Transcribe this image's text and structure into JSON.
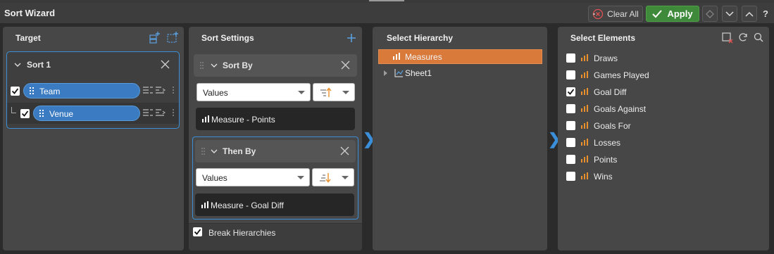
{
  "window": {
    "title": "Sort Wizard",
    "clear_all": "Clear All",
    "apply": "Apply",
    "help": "?"
  },
  "target": {
    "title": "Target",
    "sort_label": "Sort 1",
    "fields": [
      {
        "label": "Team",
        "checked": true
      },
      {
        "label": "Venue",
        "checked": true
      }
    ]
  },
  "sort_settings": {
    "title": "Sort Settings",
    "sort_by": {
      "label": "Sort By",
      "select_value": "Values",
      "direction": "ascending",
      "measure": "Measure - Points"
    },
    "then_by": {
      "label": "Then By",
      "select_value": "Values",
      "direction": "descending",
      "measure": "Measure - Goal Diff"
    },
    "break_hierarchies": {
      "label": "Break Hierarchies",
      "checked": true
    }
  },
  "hierarchy": {
    "title": "Select Hierarchy",
    "items": [
      {
        "label": "Measures",
        "selected": true
      },
      {
        "label": "Sheet1",
        "selected": false
      }
    ]
  },
  "elements": {
    "title": "Select Elements",
    "items": [
      {
        "label": "Draws",
        "checked": false
      },
      {
        "label": "Games Played",
        "checked": false
      },
      {
        "label": "Goal Diff",
        "checked": true
      },
      {
        "label": "Goals Against",
        "checked": false
      },
      {
        "label": "Goals For",
        "checked": false
      },
      {
        "label": "Losses",
        "checked": false
      },
      {
        "label": "Points",
        "checked": false
      },
      {
        "label": "Wins",
        "checked": false
      }
    ]
  },
  "colors": {
    "accent": "#3b8fd9",
    "apply_green": "#3f8a3a",
    "selection_orange": "#d9793a",
    "measure_icon": "#e8912e"
  }
}
